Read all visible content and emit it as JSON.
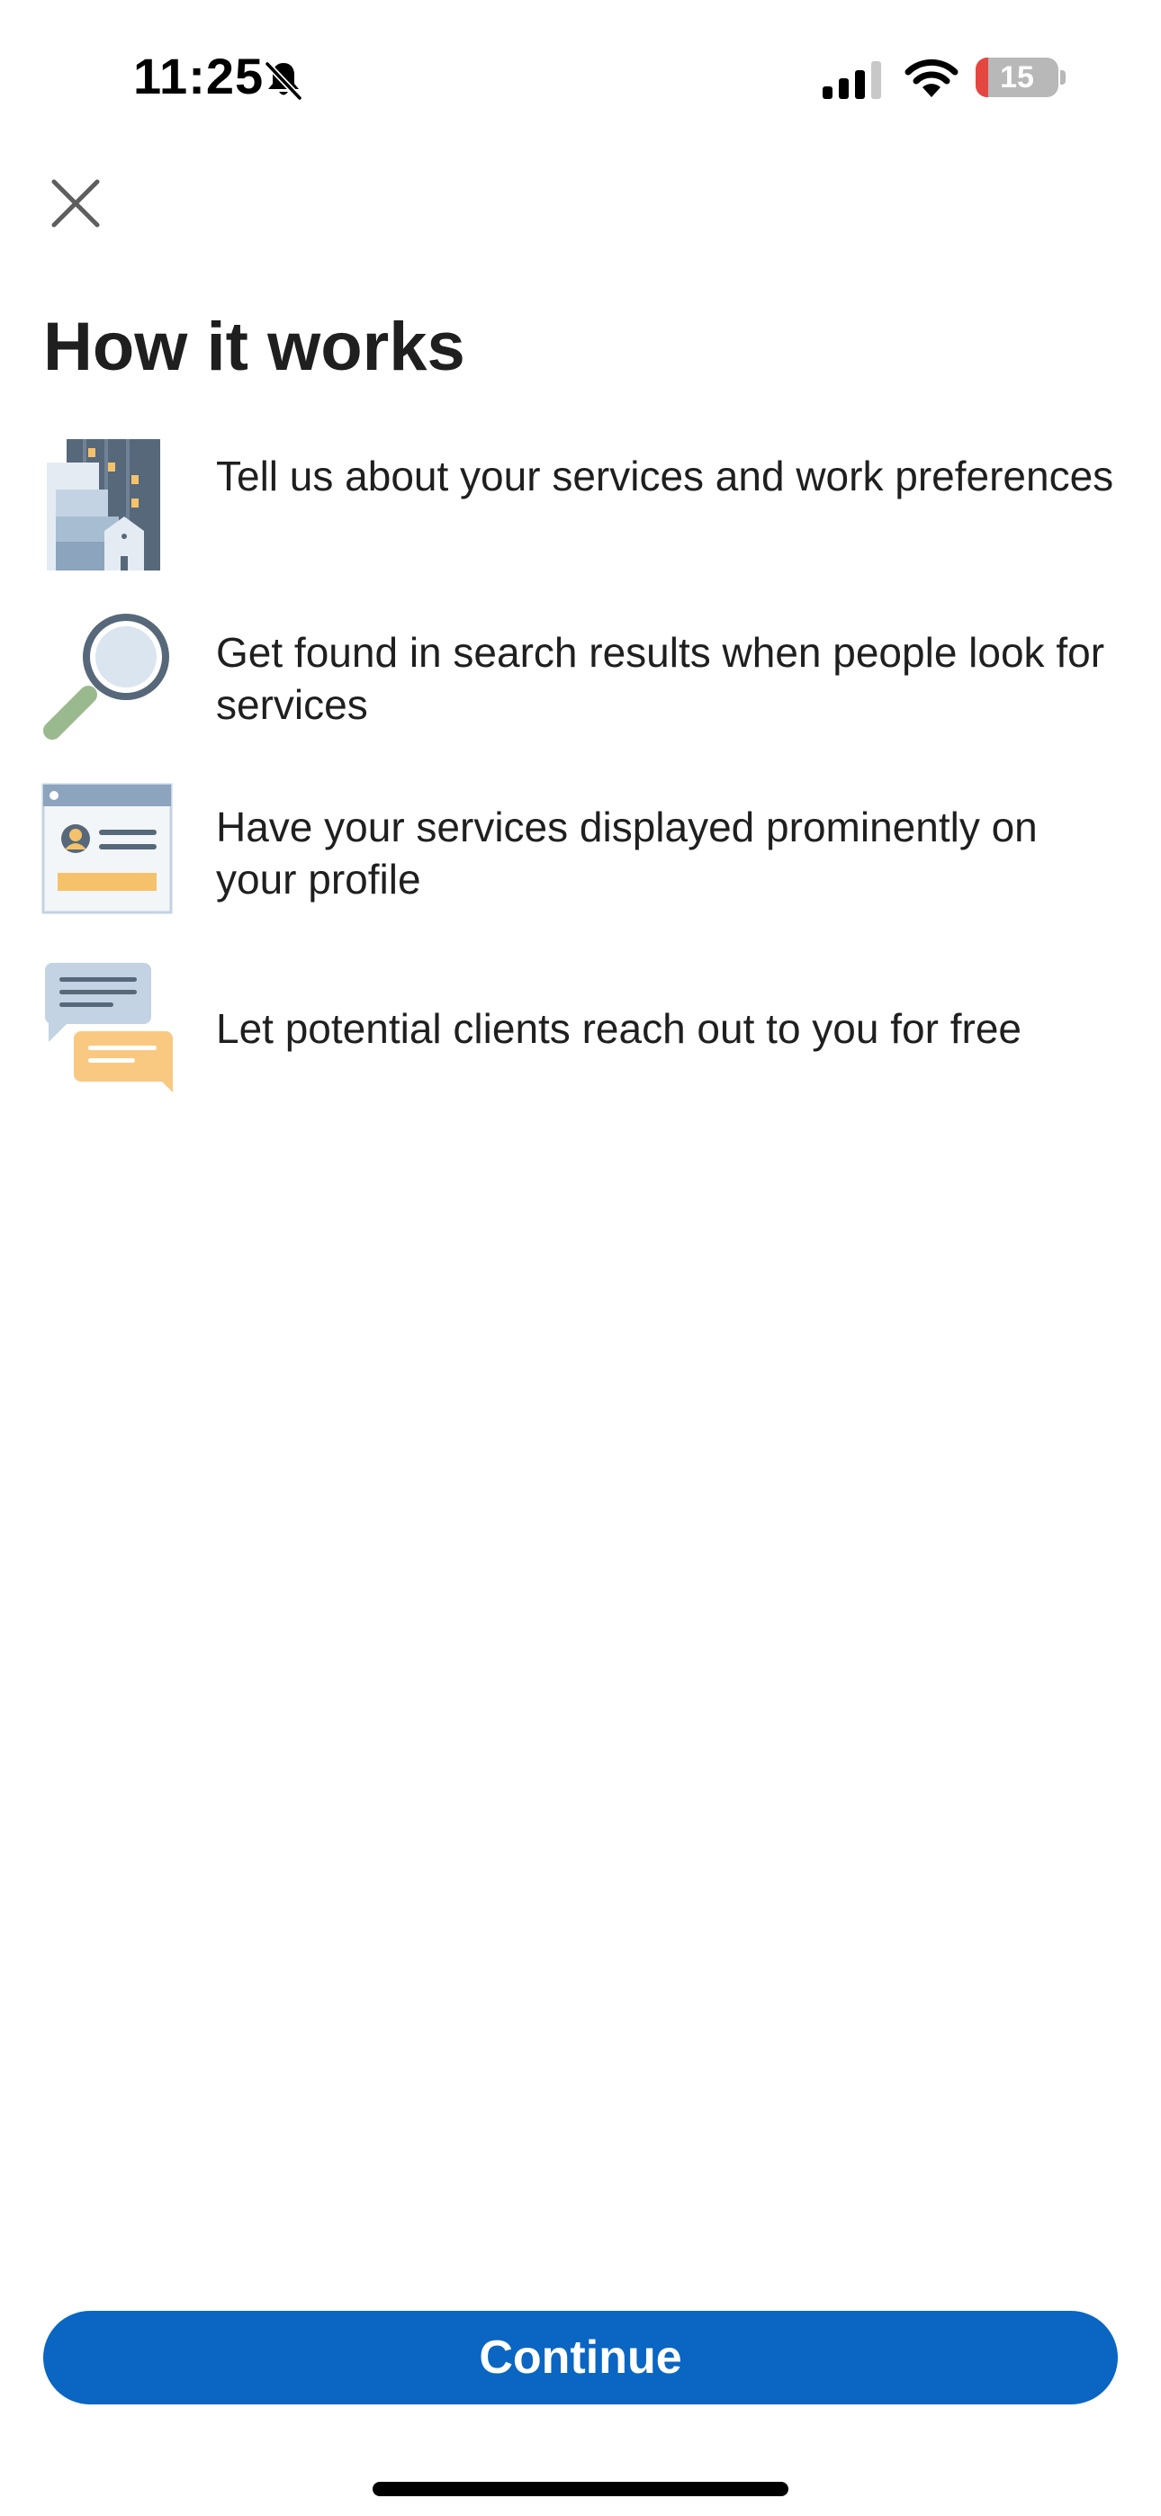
{
  "status_bar": {
    "time": "11:25",
    "battery_level": "15",
    "battery_percent": 15,
    "silent_icon": "bell-slash-icon",
    "signal_icon": "cellular-signal-icon",
    "wifi_icon": "wifi-icon"
  },
  "header": {
    "close_icon": "close-icon",
    "title": "How it works"
  },
  "steps": [
    {
      "icon": "buildings-illustration-icon",
      "text": "Tell us about your services and work preferences"
    },
    {
      "icon": "magnifying-glass-illustration-icon",
      "text": "Get found in search results when people look for services"
    },
    {
      "icon": "profile-card-illustration-icon",
      "text": "Have your services displayed prominently on your profile"
    },
    {
      "icon": "chat-bubbles-illustration-icon",
      "text": "Let potential clients reach out to you for free"
    }
  ],
  "footer": {
    "continue_label": "Continue"
  },
  "colors": {
    "accent": "#0a66c2",
    "text": "#1f1f1f",
    "battery_low": "#e64640"
  }
}
